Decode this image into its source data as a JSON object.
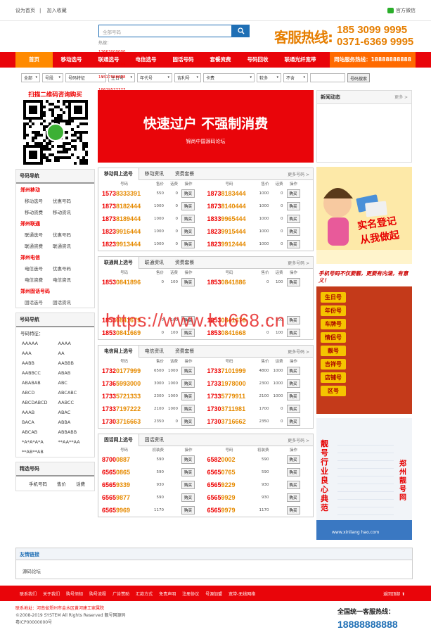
{
  "topbar": {
    "set_home": "设为首页",
    "add_fav": "加入收藏",
    "wechat": "官方微信"
  },
  "search": {
    "placeholder": "全部号码",
    "hot_label": "热搜：",
    "hot": [
      "13663000000",
      "18703899999",
      "15517588888",
      "18639577777"
    ]
  },
  "hotline": {
    "label": "客服热线:",
    "phone1": "185 3099 9995",
    "phone2": "0371-6369 9995"
  },
  "nav": {
    "items": [
      "首页",
      "移动选号",
      "联通选号",
      "电信选号",
      "固话号码",
      "套餐资费",
      "号码回收",
      "联通光纤宽带"
    ],
    "service": "网站服务热线：18888888888"
  },
  "filters": {
    "selects": [
      "全部",
      "号段",
      "号码特征",
      "生日号",
      "年代号",
      "吉利号",
      "卡费",
      "较多",
      "不含"
    ],
    "search_btn": "号码搜索"
  },
  "qr": {
    "title": "扫描二维码咨询购买"
  },
  "nav_panel": {
    "title": "号码导航",
    "sections": [
      {
        "name": "郑州移动",
        "rows": [
          [
            "移动选号",
            "优惠号码"
          ],
          [
            "移动资费",
            "移动资讯"
          ]
        ]
      },
      {
        "name": "郑州联通",
        "rows": [
          [
            "联通选号",
            "优惠号码"
          ],
          [
            "联通资费",
            "联通资讯"
          ]
        ]
      },
      {
        "name": "郑州电信",
        "rows": [
          [
            "电信选号",
            "优惠号码"
          ],
          [
            "电信资费",
            "电信资讯"
          ]
        ]
      },
      {
        "name": "郑州固话号码",
        "rows": [
          [
            "固话选号",
            "固话资讯"
          ]
        ]
      }
    ]
  },
  "feature_panel": {
    "title": "号码导航",
    "label": "号码特征：",
    "rows": [
      [
        "AAAAA",
        "AAAA"
      ],
      [
        "AAA",
        "AA"
      ],
      [
        "AABB",
        "AABBB"
      ],
      [
        "AABBCC",
        "ABAB"
      ],
      [
        "ABABAB",
        "ABC"
      ],
      [
        "ABCD",
        "ABCABC"
      ],
      [
        "ABCDABCD",
        "AABCC"
      ],
      [
        "AAAB",
        "ABAC"
      ],
      [
        "BACA",
        "ABBA"
      ],
      [
        "ABCAB",
        "ABBABB"
      ],
      [
        "*A*A*A*A",
        "**AA**AA"
      ],
      [
        "**AB**AB",
        ""
      ]
    ]
  },
  "picked_panel": {
    "title": "精选号码",
    "cols": [
      "手机号码",
      "售价",
      "话费"
    ]
  },
  "banner": {
    "title": "快速过户 不强制消费",
    "sub": "锦尚中国源码论坛"
  },
  "blocks": [
    {
      "tabs": [
        "移动网上选号",
        "移动资讯",
        "资费套餐"
      ],
      "more": "更多号码 >",
      "headers": [
        "号码",
        "售价",
        "话费",
        "操作"
      ],
      "left": [
        [
          "15738333391",
          "1573",
          "8333391",
          "550",
          "0"
        ],
        [
          "18738182444",
          "1873",
          "8182444",
          "1000",
          "0"
        ],
        [
          "18738189444",
          "1873",
          "8189444",
          "1000",
          "0"
        ],
        [
          "18239916444",
          "1823",
          "9916444",
          "1000",
          "0"
        ],
        [
          "18239913444",
          "1823",
          "9913444",
          "1000",
          "0"
        ]
      ],
      "right": [
        [
          "18738183444",
          "1873",
          "8183444",
          "1000",
          "0"
        ],
        [
          "18738140444",
          "1873",
          "8140444",
          "1000",
          "0"
        ],
        [
          "18339965444",
          "1833",
          "9965444",
          "1000",
          "0"
        ],
        [
          "18239915444",
          "1823",
          "9915444",
          "1000",
          "0"
        ],
        [
          "18239912444",
          "1823",
          "9912444",
          "1000",
          "0"
        ]
      ]
    },
    {
      "tabs": [
        "联通网上选号",
        "联通资讯",
        "资费套餐"
      ],
      "more": "更多号码 >",
      "headers": [
        "号码",
        "售价",
        "话费",
        "操作"
      ],
      "left": [
        [
          "18530841896",
          "1853",
          "0841896",
          "0",
          "100"
        ],
        [
          "",
          "",
          "",
          "",
          ""
        ],
        [
          "",
          "",
          "",
          "",
          ""
        ],
        [
          "18530841679",
          "1853",
          "0841679",
          "0",
          "100"
        ],
        [
          "18530841669",
          "1853",
          "0841669",
          "0",
          "100"
        ]
      ],
      "right": [
        [
          "18530841886",
          "1853",
          "0841886",
          "0",
          "100"
        ],
        [
          "",
          "",
          "",
          "",
          ""
        ],
        [
          "",
          "",
          "",
          "",
          ""
        ],
        [
          "18530841676",
          "1853",
          "0841676",
          "0",
          "100"
        ],
        [
          "18530841668",
          "1853",
          "0841668",
          "0",
          "100"
        ]
      ]
    },
    {
      "tabs": [
        "电信网上选号",
        "电信资讯",
        "资费套餐"
      ],
      "more": "更多号码 >",
      "headers": [
        "号码",
        "售价",
        "话费",
        "操作"
      ],
      "left": [
        [
          "17320177999",
          "1732",
          "0177999",
          "6500",
          "1000"
        ],
        [
          "17365993000",
          "1736",
          "5993000",
          "3000",
          "1000"
        ],
        [
          "17335721333",
          "1733",
          "5721333",
          "2300",
          "1000"
        ],
        [
          "17337197222",
          "1733",
          "7197222",
          "2100",
          "1000"
        ],
        [
          "17303716663",
          "1730",
          "3716663",
          "2350",
          "0"
        ]
      ],
      "right": [
        [
          "17337101999",
          "1733",
          "7101999",
          "4800",
          "1000"
        ],
        [
          "17331978000",
          "1733",
          "1978000",
          "2300",
          "1000"
        ],
        [
          "17335779911",
          "1733",
          "5779911",
          "2100",
          "1000"
        ],
        [
          "17303711981",
          "1730",
          "3711981",
          "1700",
          "0"
        ],
        [
          "17303716662",
          "1730",
          "3716662",
          "2350",
          "0"
        ]
      ]
    },
    {
      "tabs": [
        "固话网上选号",
        "固话资讯"
      ],
      "more": "更多号码 >",
      "headers": [
        "号码",
        "初装费",
        "",
        "操作"
      ],
      "left": [
        [
          "87000887",
          "8700",
          "0887",
          "590",
          ""
        ],
        [
          "65650865",
          "6565",
          "0865",
          "590",
          ""
        ],
        [
          "65659339",
          "6565",
          "9339",
          "930",
          ""
        ],
        [
          "65659877",
          "6565",
          "9877",
          "590",
          ""
        ],
        [
          "65659969",
          "6565",
          "9969",
          "1170",
          ""
        ]
      ],
      "right": [
        [
          "65820002",
          "6582",
          "0002",
          "590",
          ""
        ],
        [
          "65650765",
          "6565",
          "0765",
          "590",
          ""
        ],
        [
          "65659229",
          "6565",
          "9229",
          "930",
          ""
        ],
        [
          "65659929",
          "6565",
          "9929",
          "930",
          ""
        ],
        [
          "65659979",
          "6565",
          "9979",
          "1170",
          ""
        ]
      ]
    }
  ],
  "buy_label": "购买",
  "news": {
    "title": "新闻动态",
    "more": "更多 >"
  },
  "ads": {
    "ad1_title": "实名登记",
    "ad1_sub": "从我做起",
    "ad2_title": "手机号码不仅要靓，更要有内涵，有意义！",
    "ad2_tags": [
      "生日号",
      "年份号",
      "车牌号",
      "情侣号",
      "靓号",
      "吉祥号",
      "店铺号",
      "区号"
    ],
    "ad3_title": "郑州靓号网",
    "ad3_vert": "靓号行业良心典范",
    "ad3_url": "www.xinliang hao.com"
  },
  "friend": {
    "title": "友情链接",
    "item": "源码论坛"
  },
  "footer": {
    "links": [
      "联系我们",
      "关于我们",
      "购号须知",
      "购号流程",
      "广告赞助",
      "汇款方式",
      "免责声明",
      "注册协议",
      "号源加盟",
      "宽带-无线网络"
    ],
    "back_top": "返回顶部 ⬆"
  },
  "copyright": {
    "address": "联系地址：河南省郑州市金水区黄河建工家属院",
    "copy": "©2008-2019 SYSTEM All Rights Reserved 靓号网源码",
    "icp": "粤ICP00000000号"
  },
  "foot_hotline": {
    "title": "全国统一客服热线：",
    "phone": "18888888888"
  },
  "watermark": "https://www.ku668.cn",
  "colors": {
    "brand_red": "#e9050a",
    "accent_orange": "#ff8a00",
    "link_blue": "#1f6fb5"
  }
}
